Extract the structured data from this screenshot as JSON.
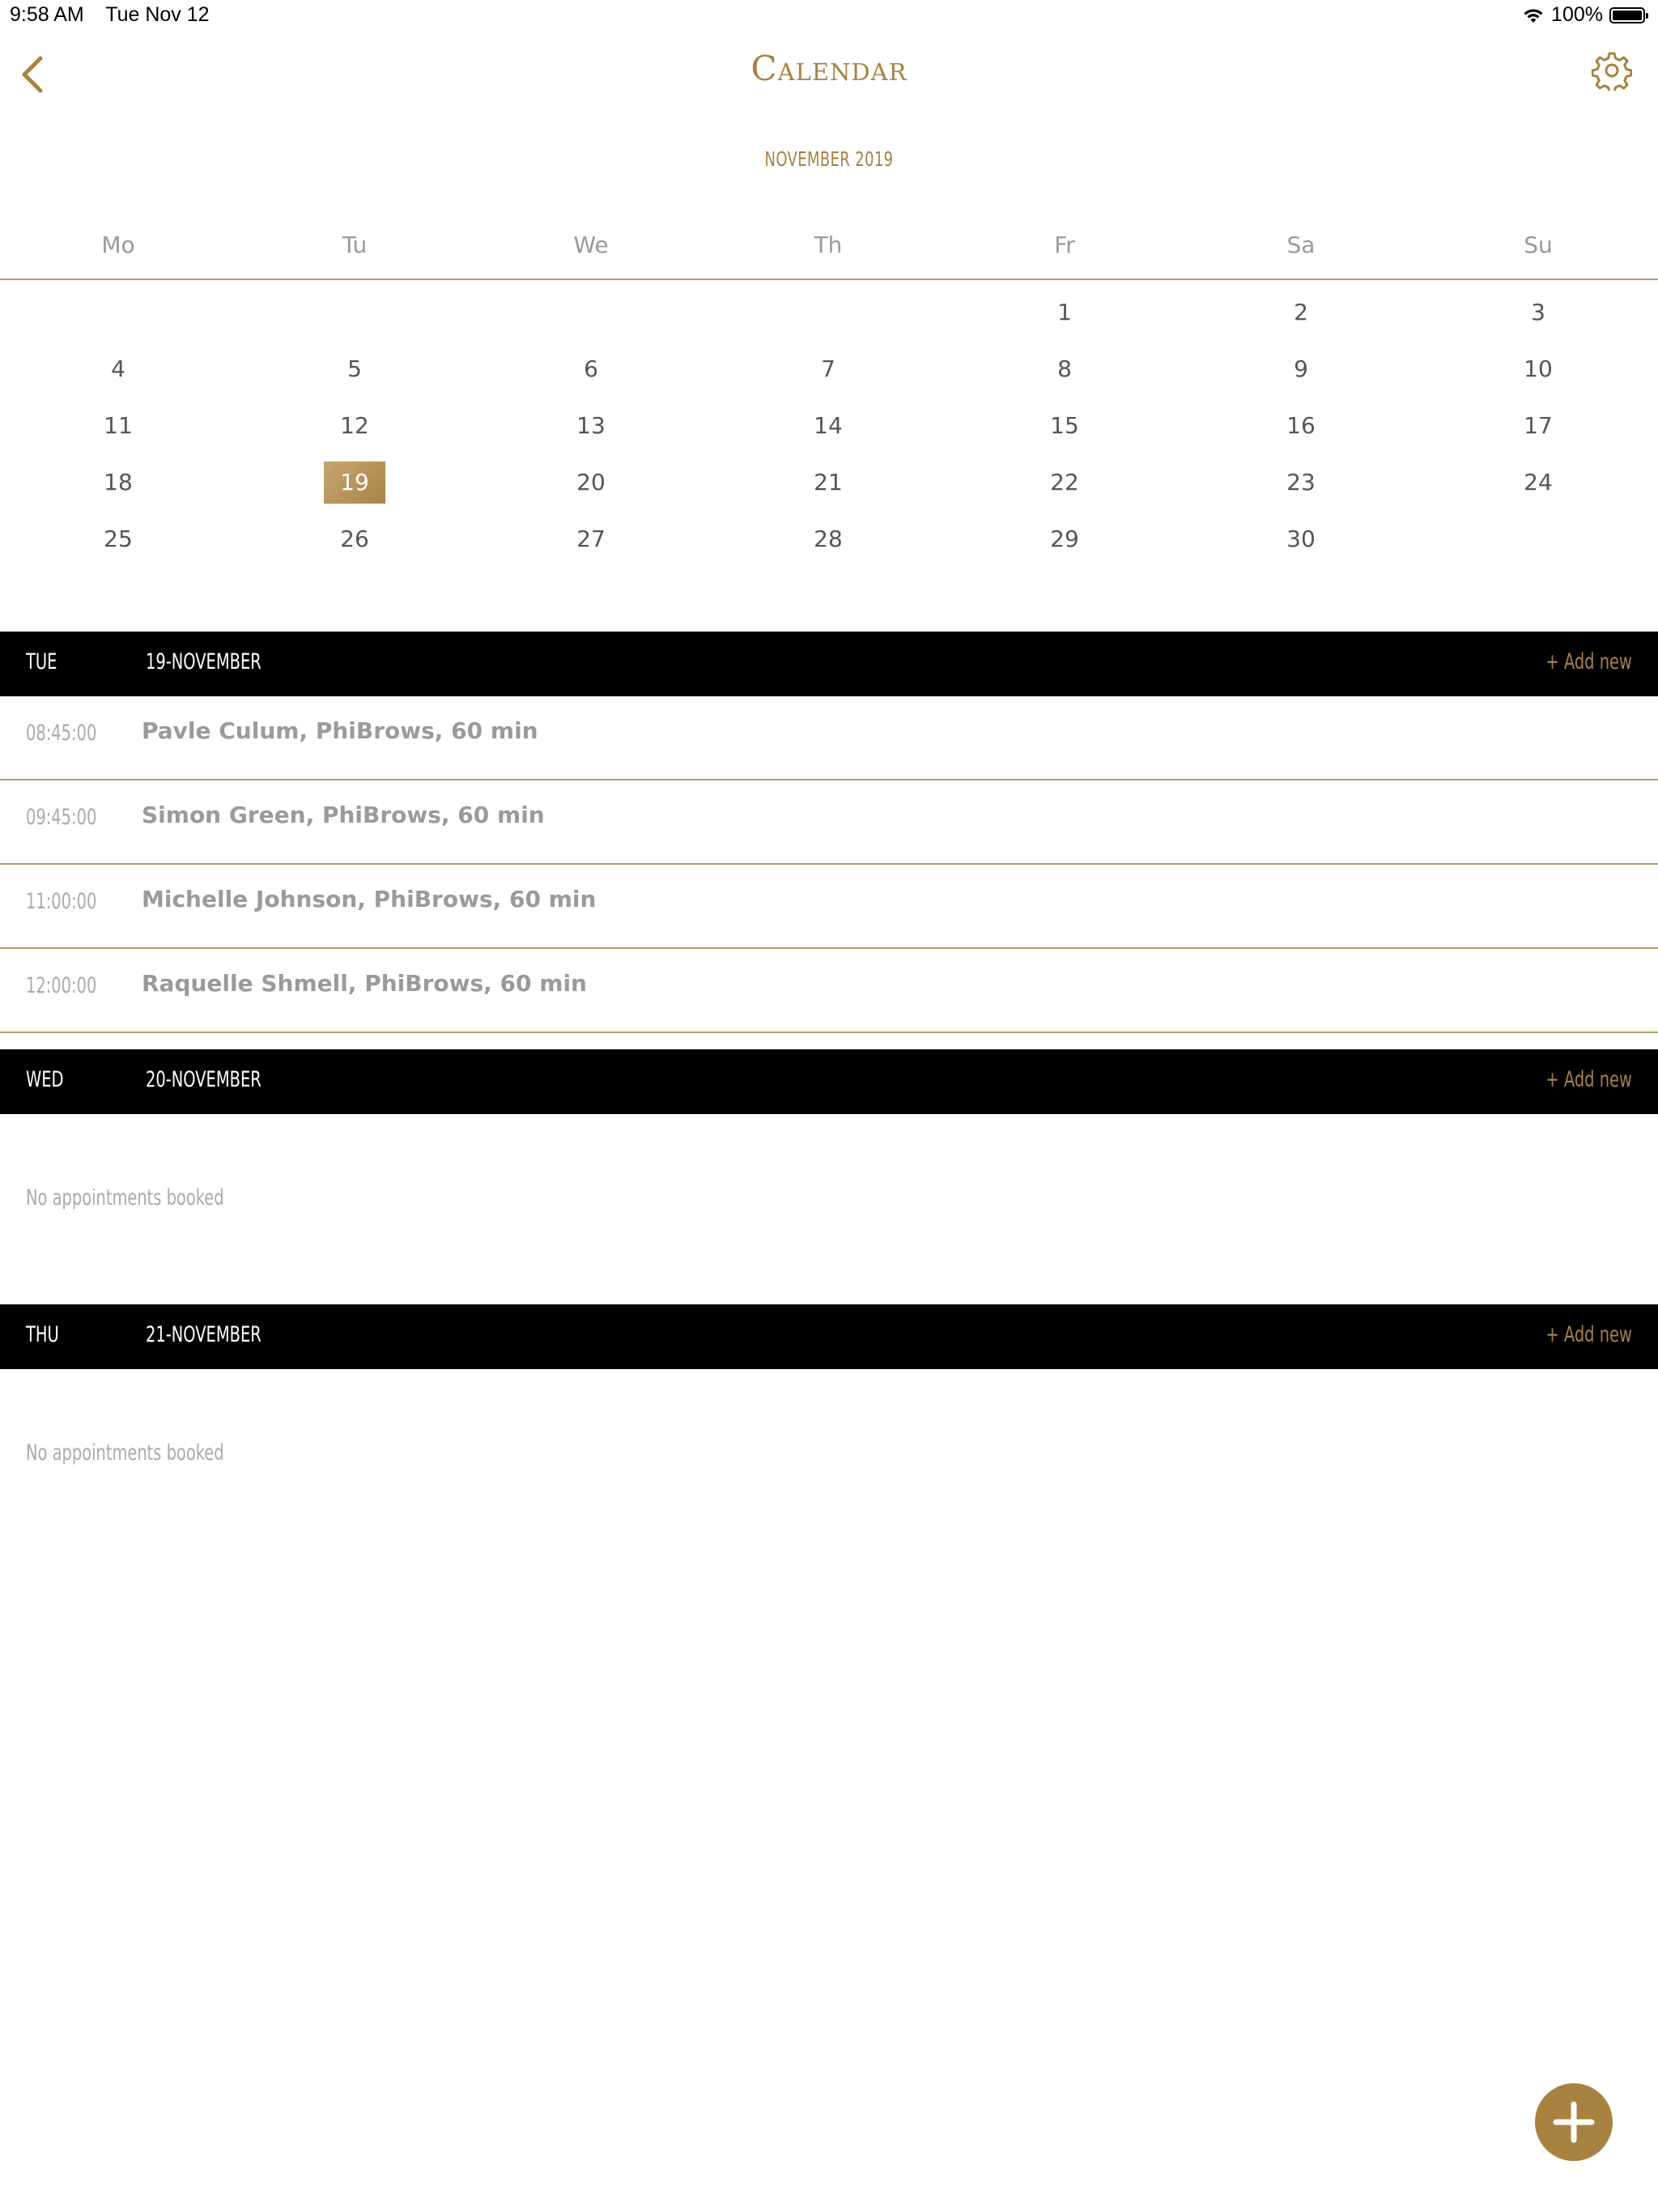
{
  "status_bar": {
    "time": "9:58 AM",
    "date": "Tue Nov 12",
    "battery": "100%"
  },
  "nav": {
    "title": "Calendar"
  },
  "calendar": {
    "month_label": "NOVEMBER 2019",
    "weekdays": [
      "Mo",
      "Tu",
      "We",
      "Th",
      "Fr",
      "Sa",
      "Su"
    ],
    "weeks": [
      [
        "",
        "",
        "",
        "",
        "1",
        "2",
        "3"
      ],
      [
        "4",
        "5",
        "6",
        "7",
        "8",
        "9",
        "10"
      ],
      [
        "11",
        "12",
        "13",
        "14",
        "15",
        "16",
        "17"
      ],
      [
        "18",
        "19",
        "20",
        "21",
        "22",
        "23",
        "24"
      ],
      [
        "25",
        "26",
        "27",
        "28",
        "29",
        "30",
        ""
      ]
    ],
    "selected_day": "19"
  },
  "sections": [
    {
      "day": "TUE",
      "date": "19-NOVEMBER",
      "add_label": "+ Add new",
      "appointments": [
        {
          "time": "08:45:00",
          "text": "Pavle Culum, PhiBrows, 60 min"
        },
        {
          "time": "09:45:00",
          "text": "Simon Green, PhiBrows, 60 min"
        },
        {
          "time": "11:00:00",
          "text": "Michelle Johnson, PhiBrows, 60 min"
        },
        {
          "time": "12:00:00",
          "text": "Raquelle Shmell, PhiBrows, 60 min"
        }
      ]
    },
    {
      "day": "WED",
      "date": "20-NOVEMBER",
      "add_label": "+ Add new",
      "empty_label": "No appointments booked"
    },
    {
      "day": "THU",
      "date": "21-NOVEMBER",
      "add_label": "+ Add new",
      "empty_label": "No appointments booked"
    }
  ],
  "colors": {
    "accent": "#a8823f",
    "header_bg": "#000000",
    "divider": "#b89a68"
  },
  "icons": {
    "back": "chevron-left-icon",
    "settings": "gear-icon",
    "fab": "plus-icon",
    "wifi": "wifi-icon",
    "battery": "battery-icon"
  }
}
